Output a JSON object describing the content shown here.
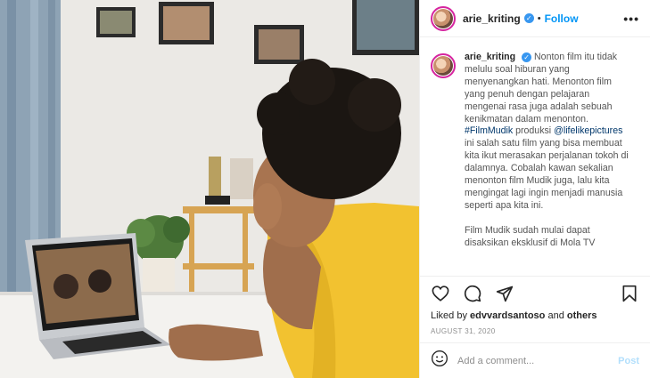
{
  "header": {
    "username": "arie_kriting",
    "separator": "•",
    "follow_label": "Follow",
    "more_label": "•••",
    "verified_icon": "verified-badge-icon"
  },
  "caption": {
    "username": "arie_kriting",
    "text_1": "Nonton film itu tidak melulu soal hiburan yang menyenangkan hati. Menonton film yang penuh dengan pelajaran mengenai rasa juga adalah sebuah kenikmatan dalam menonton.",
    "hashtag": "#FilmMudik",
    "text_2": " produksi ",
    "mention": "@lifelikepictures",
    "text_3": " ini salah satu film yang bisa membuat kita ikut merasakan perjalanan tokoh di dalamnya. Cobalah kawan sekalian menonton film Mudik juga, lalu kita mengingat lagi ingin menjadi manusia seperti apa kita ini.",
    "text_4": "Film Mudik sudah mulai dapat disaksikan eksklusif di Mola TV"
  },
  "actions": {
    "icons": [
      "heart-icon",
      "comment-icon",
      "share-icon",
      "bookmark-icon"
    ]
  },
  "likes": {
    "prefix": "Liked by ",
    "user": "edvvardsantoso",
    "middle": " and ",
    "others": "others"
  },
  "date": "AUGUST 31, 2020",
  "comment_box": {
    "placeholder": "Add a comment...",
    "post_label": "Post",
    "emoji_icon": "emoji-icon"
  },
  "colors": {
    "accent": "#0095f6",
    "verified": "#3897f0",
    "shirt": "#f2c230",
    "wall": "#e9e7e3"
  }
}
